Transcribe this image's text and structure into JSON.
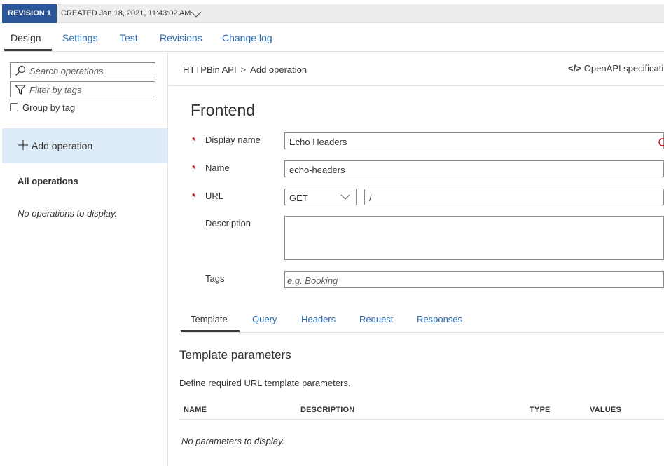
{
  "revision": {
    "badge": "REVISION 1",
    "created": "CREATED Jan 18, 2021, 11:43:02 AM"
  },
  "tabs": [
    {
      "label": "Design",
      "active": true
    },
    {
      "label": "Settings"
    },
    {
      "label": "Test"
    },
    {
      "label": "Revisions"
    },
    {
      "label": "Change log"
    }
  ],
  "sidebar": {
    "search_placeholder": "Search operations",
    "filter_placeholder": "Filter by tags",
    "group_by_tag": "Group by tag",
    "add_operation": "Add operation",
    "all_operations": "All operations",
    "empty": "No operations to display."
  },
  "header": {
    "breadcrumb_api": "HTTPBin API",
    "breadcrumb_sep": ">",
    "breadcrumb_page": "Add operation",
    "openapi_code": "</>",
    "openapi_label": "OpenAPI specificati"
  },
  "form": {
    "title": "Frontend",
    "required_mark": "*",
    "display_name_label": "Display name",
    "display_name_value": "Echo Headers",
    "name_label": "Name",
    "name_value": "echo-headers",
    "url_label": "URL",
    "method_value": "GET",
    "url_value": "/",
    "description_label": "Description",
    "description_value": "",
    "tags_label": "Tags",
    "tags_placeholder": "e.g. Booking"
  },
  "subtabs": [
    {
      "label": "Template",
      "active": true
    },
    {
      "label": "Query"
    },
    {
      "label": "Headers"
    },
    {
      "label": "Request"
    },
    {
      "label": "Responses"
    }
  ],
  "template_params": {
    "title": "Template parameters",
    "description": "Define required URL template parameters.",
    "columns": [
      "NAME",
      "DESCRIPTION",
      "TYPE",
      "VALUES"
    ],
    "empty": "No parameters to display."
  },
  "colors": {
    "badge_bg": "#2b579a",
    "link": "#2b6cb0",
    "selected_bg": "#deecf9",
    "required": "#c50f1f"
  }
}
